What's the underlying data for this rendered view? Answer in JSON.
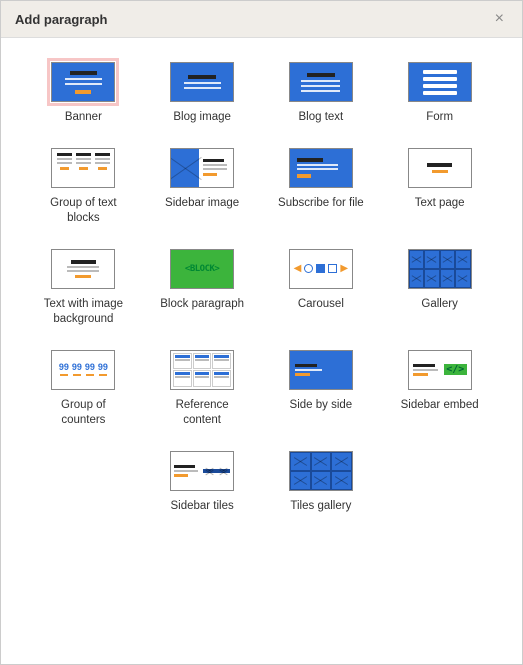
{
  "dialog": {
    "title": "Add paragraph",
    "close_label": "Close"
  },
  "options": [
    {
      "id": "banner",
      "label": "Banner",
      "selected": true
    },
    {
      "id": "blog-image",
      "label": "Blog image",
      "selected": false
    },
    {
      "id": "blog-text",
      "label": "Blog text",
      "selected": false
    },
    {
      "id": "form",
      "label": "Form",
      "selected": false
    },
    {
      "id": "group-text-blocks",
      "label": "Group of text blocks",
      "selected": false
    },
    {
      "id": "sidebar-image",
      "label": "Sidebar image",
      "selected": false
    },
    {
      "id": "subscribe-file",
      "label": "Subscribe for file",
      "selected": false
    },
    {
      "id": "text-page",
      "label": "Text page",
      "selected": false
    },
    {
      "id": "text-with-img-bg",
      "label": "Text with image background",
      "selected": false
    },
    {
      "id": "block-paragraph",
      "label": "Block paragraph",
      "selected": false
    },
    {
      "id": "carousel",
      "label": "Carousel",
      "selected": false
    },
    {
      "id": "gallery",
      "label": "Gallery",
      "selected": false
    },
    {
      "id": "group-counters",
      "label": "Group of counters",
      "selected": false
    },
    {
      "id": "reference-content",
      "label": "Reference content",
      "selected": false
    },
    {
      "id": "side-by-side",
      "label": "Side by side",
      "selected": false
    },
    {
      "id": "sidebar-embed",
      "label": "Sidebar embed",
      "selected": false
    },
    {
      "id": "sidebar-tiles",
      "label": "Sidebar tiles",
      "selected": false
    },
    {
      "id": "tiles-gallery",
      "label": "Tiles gallery",
      "selected": false
    }
  ],
  "icons": {
    "block_text": "BLOCK",
    "counter_value": "99",
    "embed_code": "</>"
  }
}
